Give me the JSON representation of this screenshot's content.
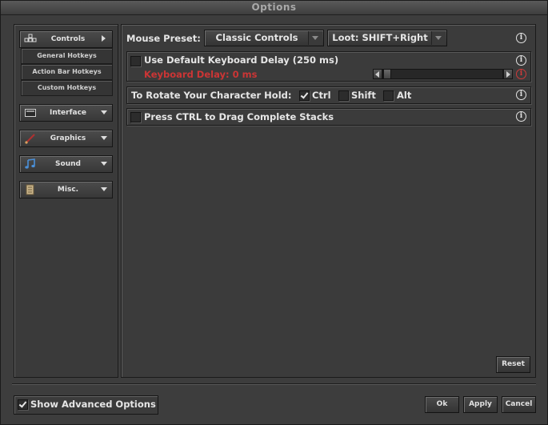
{
  "window": {
    "title": "Options"
  },
  "nav": {
    "controls": {
      "label": "Controls",
      "icon": "controls-icon"
    },
    "sub_items": [
      "General Hotkeys",
      "Action Bar Hotkeys",
      "Custom Hotkeys"
    ],
    "interface": {
      "label": "Interface",
      "icon": "monitor-icon"
    },
    "graphics": {
      "label": "Graphics",
      "icon": "brush-icon"
    },
    "sound": {
      "label": "Sound",
      "icon": "music-note-icon"
    },
    "misc": {
      "label": "Misc.",
      "icon": "scroll-icon"
    }
  },
  "main": {
    "mouse_preset_label": "Mouse Preset:",
    "mouse_preset_value": "Classic Controls",
    "loot_value": "Loot: SHIFT+Right",
    "keyboard_delay_label": "Use Default Keyboard Delay (250 ms)",
    "keyboard_delay_value": "Keyboard Delay: 0 ms",
    "rotate_label": "To Rotate Your Character Hold:",
    "rotate_options": [
      {
        "label": "Ctrl",
        "checked": true
      },
      {
        "label": "Shift",
        "checked": false
      },
      {
        "label": "Alt",
        "checked": false
      }
    ],
    "drag_stacks_label": "Press CTRL to Drag Complete Stacks",
    "reset_label": "Reset"
  },
  "footer": {
    "advanced_label": "Show Advanced Options",
    "advanced_checked": true,
    "ok_label": "Ok",
    "apply_label": "Apply",
    "cancel_label": "Cancel"
  },
  "colors": {
    "background": "#3b3b3b",
    "text": "#e6e6e6",
    "warning_red": "#cc3535"
  }
}
